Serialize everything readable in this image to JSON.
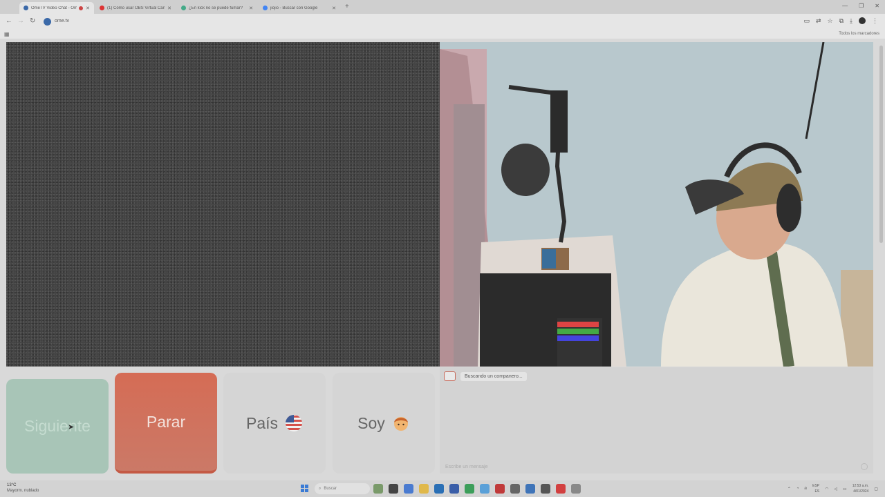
{
  "browser": {
    "tabs": [
      {
        "title": "OmeTV Video Chat - Ome",
        "active": true,
        "favicon_color": "#3b69a8"
      },
      {
        "title": "(1) Cómo usar OBS Virtual Cam",
        "active": false,
        "favicon_color": "#d33"
      },
      {
        "title": "¿En kick no se puede fumar?",
        "active": false,
        "favicon_color": "#4a8"
      },
      {
        "title": "jiojio - Buscar con Google",
        "active": false,
        "favicon_color": "#4285f4"
      }
    ],
    "url": "ome.tv",
    "bookmarks_label": "Todos los marcadores"
  },
  "controls": {
    "next_label": "Siguiente",
    "stop_label": "Parar",
    "country_label": "País",
    "iam_label": "Soy"
  },
  "chat": {
    "status_message": "Buscando un companero...",
    "input_placeholder": "Escribe un mensaje"
  },
  "taskbar": {
    "weather_temp": "13°C",
    "weather_desc": "Mayorm. nublado",
    "search_placeholder": "Buscar",
    "lang": "ESP",
    "lang_sub": "ES",
    "time": "12:53 a.m.",
    "date": "4/01/2024"
  },
  "colors": {
    "next": "#a8c5b7",
    "stop": "#d56c55",
    "neutral": "#d5d5d5"
  }
}
